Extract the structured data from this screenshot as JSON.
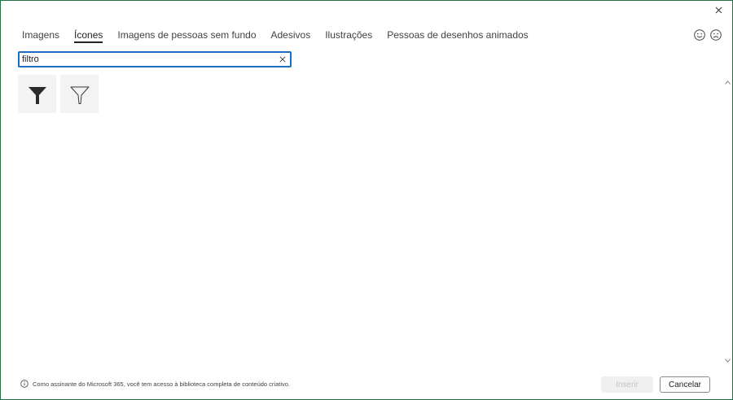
{
  "tabs": [
    {
      "label": "Imagens"
    },
    {
      "label": "Ícones"
    },
    {
      "label": "Imagens de pessoas sem fundo"
    },
    {
      "label": "Adesivos"
    },
    {
      "label": "Ilustrações"
    },
    {
      "label": "Pessoas de desenhos animados"
    }
  ],
  "active_tab": "Ícones",
  "search": {
    "value": "filtro"
  },
  "results": [
    {
      "icon": "funnel-filled-icon"
    },
    {
      "icon": "funnel-outline-icon"
    }
  ],
  "footer": {
    "info_text": "Como assinante do Microsoft 365, você tem acesso à biblioteca completa de conteúdo criativo.",
    "insert_label": "Inserir",
    "cancel_label": "Cancelar"
  },
  "colors": {
    "accent": "#1b6ec2",
    "border": "#217346"
  }
}
